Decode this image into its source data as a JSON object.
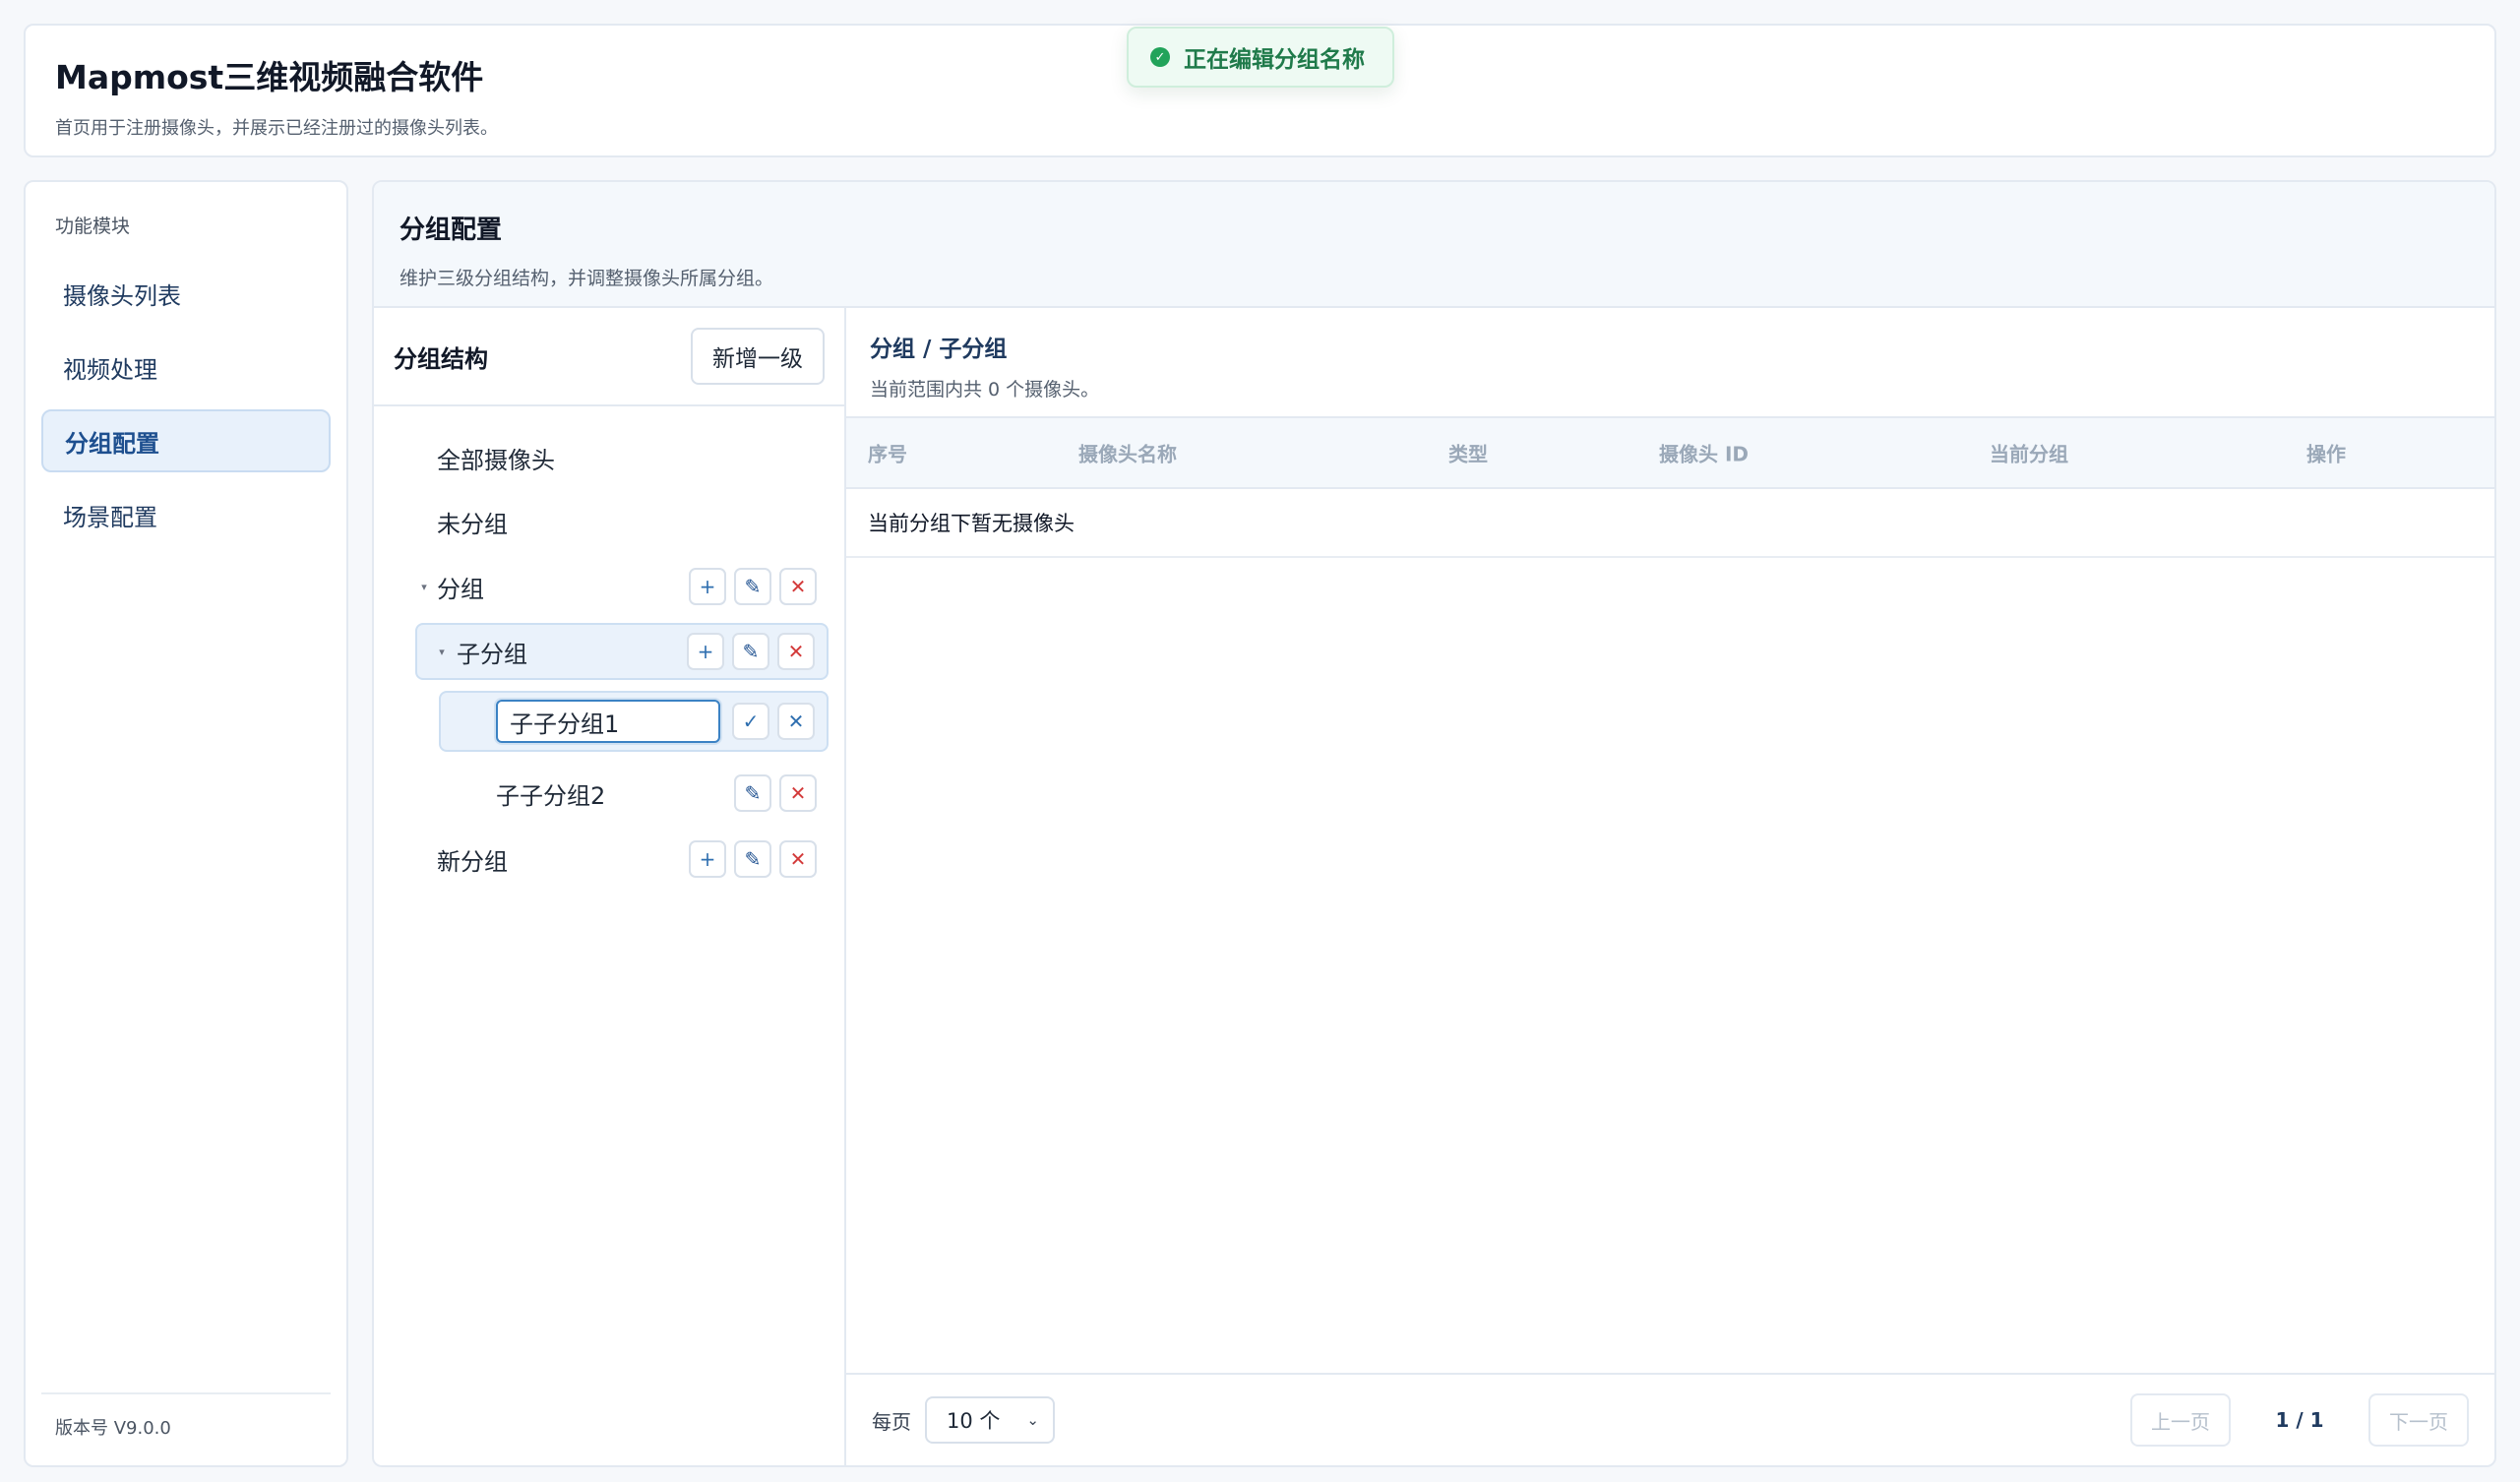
{
  "app": {
    "title": "Mapmost三维视频融合软件",
    "description": "首页用于注册摄像头，并展示已经注册过的摄像头列表。"
  },
  "toast": {
    "message": "正在编辑分组名称",
    "icon": "check-circle-icon",
    "color": "#22a35a"
  },
  "sidebar": {
    "heading": "功能模块",
    "items": [
      {
        "label": "摄像头列表",
        "active": false
      },
      {
        "label": "视频处理",
        "active": false
      },
      {
        "label": "分组配置",
        "active": true
      },
      {
        "label": "场景配置",
        "active": false
      }
    ],
    "version": "版本号 V9.0.0"
  },
  "main": {
    "title": "分组配置",
    "description": "维护三级分组结构，并调整摄像头所属分组。"
  },
  "tree": {
    "title": "分组结构",
    "add_root_label": "新增一级",
    "items": [
      {
        "label": "全部摄像头"
      },
      {
        "label": "未分组"
      },
      {
        "label": "分组",
        "expanded": true
      },
      {
        "label": "子分组",
        "expanded": true,
        "selected": true
      },
      {
        "label": "子子分组1",
        "editing": true,
        "input_value": "子子分组1"
      },
      {
        "label": "子子分组2"
      },
      {
        "label": "新分组"
      }
    ],
    "icons": {
      "add": "+",
      "edit": "✎",
      "delete": "✕",
      "confirm": "✓",
      "cancel": "✕",
      "caret": "▾"
    }
  },
  "table": {
    "breadcrumb": "分组 / 子分组",
    "count_text": "当前范围内共 0 个摄像头。",
    "columns": [
      "序号",
      "摄像头名称",
      "类型",
      "摄像头 ID",
      "当前分组",
      "操作"
    ],
    "rows": [],
    "empty_text": "当前分组下暂无摄像头"
  },
  "pagination": {
    "per_page_label": "每页",
    "per_page_value": "10 个",
    "prev_label": "上一页",
    "page_indicator": "1 / 1",
    "next_label": "下一页"
  },
  "colors": {
    "accent": "#1d4f8f",
    "danger": "#d33a3a",
    "success": "#22a35a"
  }
}
